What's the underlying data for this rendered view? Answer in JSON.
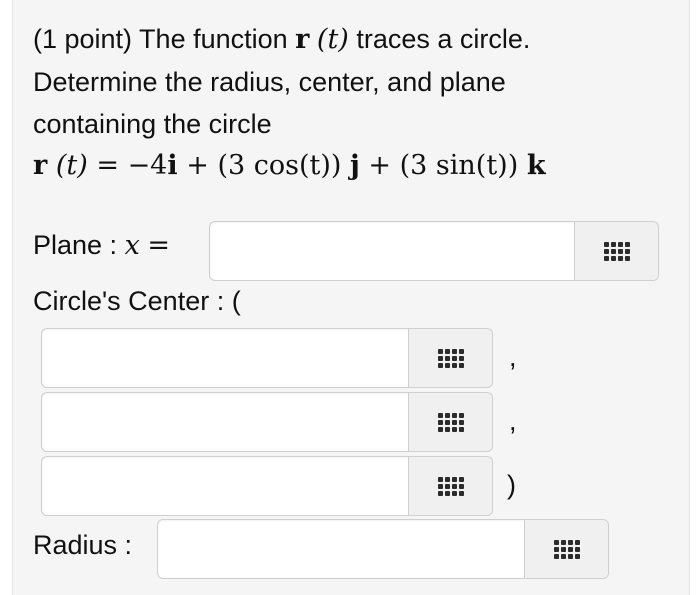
{
  "problem": {
    "intro_points": "(1 point) The function",
    "r_symbol": "r",
    "t_arg": "(t)",
    "intro_rest": "traces a circle.",
    "line2": "Determine the radius, center, and plane",
    "line3": "containing the circle",
    "equation": {
      "lhs_r": "r",
      "lhs_t": "(t)",
      "equals": "=",
      "term1": "−4",
      "i": "i",
      "plus1": "+",
      "term2_open": "(3 cos(t))",
      "j": "j",
      "plus2": "+",
      "term3_open": "(3 sin(t))",
      "k": "k"
    }
  },
  "plane": {
    "label": "Plane :",
    "var": "x",
    "equals": "=",
    "value": "",
    "button_icon": "grid-icon"
  },
  "center": {
    "label": "Circle's Center : (",
    "fields": [
      {
        "value": "",
        "sep": ","
      },
      {
        "value": "",
        "sep": ","
      },
      {
        "value": "",
        "sep": ")"
      }
    ],
    "button_icon": "grid-icon"
  },
  "radius": {
    "label": "Radius :",
    "value": "",
    "button_icon": "grid-icon"
  }
}
